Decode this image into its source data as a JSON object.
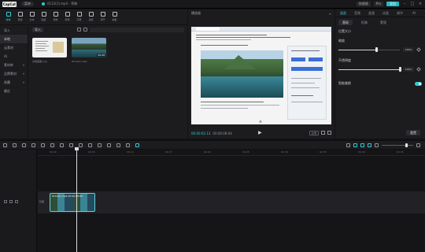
{
  "titlebar": {
    "logo": "CapCut",
    "menu_label": "菜单",
    "project_title": "0112(1).mp4 - 草稿",
    "chips": [
      "快捷键",
      "Pro"
    ],
    "export_label": "导出"
  },
  "toolbar": {
    "tools": [
      {
        "label": "媒体",
        "icon": "media-icon"
      },
      {
        "label": "音频",
        "icon": "audio-icon"
      },
      {
        "label": "文本",
        "icon": "text-icon"
      },
      {
        "label": "贴纸",
        "icon": "sticker-icon"
      },
      {
        "label": "特效",
        "icon": "effects-icon"
      },
      {
        "label": "转场",
        "icon": "transition-icon"
      },
      {
        "label": "字幕",
        "icon": "captions-icon"
      },
      {
        "label": "滤镜",
        "icon": "filter-icon"
      },
      {
        "label": "调节",
        "icon": "adjust-icon"
      },
      {
        "label": "模板",
        "icon": "template-icon"
      }
    ]
  },
  "sidebar": {
    "items": [
      {
        "label": "导入",
        "caret": ""
      },
      {
        "label": "本地",
        "caret": ""
      },
      {
        "label": "云素材",
        "caret": ""
      },
      {
        "label": "AI",
        "caret": ""
      },
      {
        "label": "素材库",
        "caret": "▾"
      },
      {
        "label": "品牌素材",
        "caret": "▾"
      },
      {
        "label": "收藏",
        "caret": "▾"
      },
      {
        "label": "最近",
        "caret": ""
      }
    ]
  },
  "media": {
    "import_label": "导入",
    "thumbs": [
      {
        "name": "文档截图.png",
        "duration": ""
      },
      {
        "name": "0112(1).mp4",
        "duration": "00:08"
      }
    ]
  },
  "player": {
    "title": "播放器",
    "timecode_current": "00:00:02:13",
    "timecode_total": "00:00:08:04",
    "ratio_label": "比例",
    "zoom_label": "适应"
  },
  "properties": {
    "tabs": [
      "画面",
      "音频",
      "变速",
      "动画",
      "调节",
      "AI"
    ],
    "subtabs": [
      "基础",
      "抠像",
      "蒙版"
    ],
    "section_title": "位置大小",
    "sliders": [
      {
        "label": "缩放",
        "value": "100%",
        "fraction": 0.62
      },
      {
        "label": "不透明度",
        "value": "100%",
        "fraction": 1.0
      }
    ],
    "toggle_label": "智能美颜",
    "reset_label": "重置"
  },
  "timeline": {
    "ruler_labels": [
      "00:00",
      "00:05",
      "00:10",
      "00:15",
      "00:20",
      "00:25",
      "00:30",
      "00:35",
      "00:40",
      "00:45"
    ],
    "clip_label": "0112(1).mp4  00:00:08:04",
    "cover_label": "封面"
  },
  "colors": {
    "accent": "#35c9d2",
    "background": "#121214",
    "panel": "#1c1c1f"
  }
}
